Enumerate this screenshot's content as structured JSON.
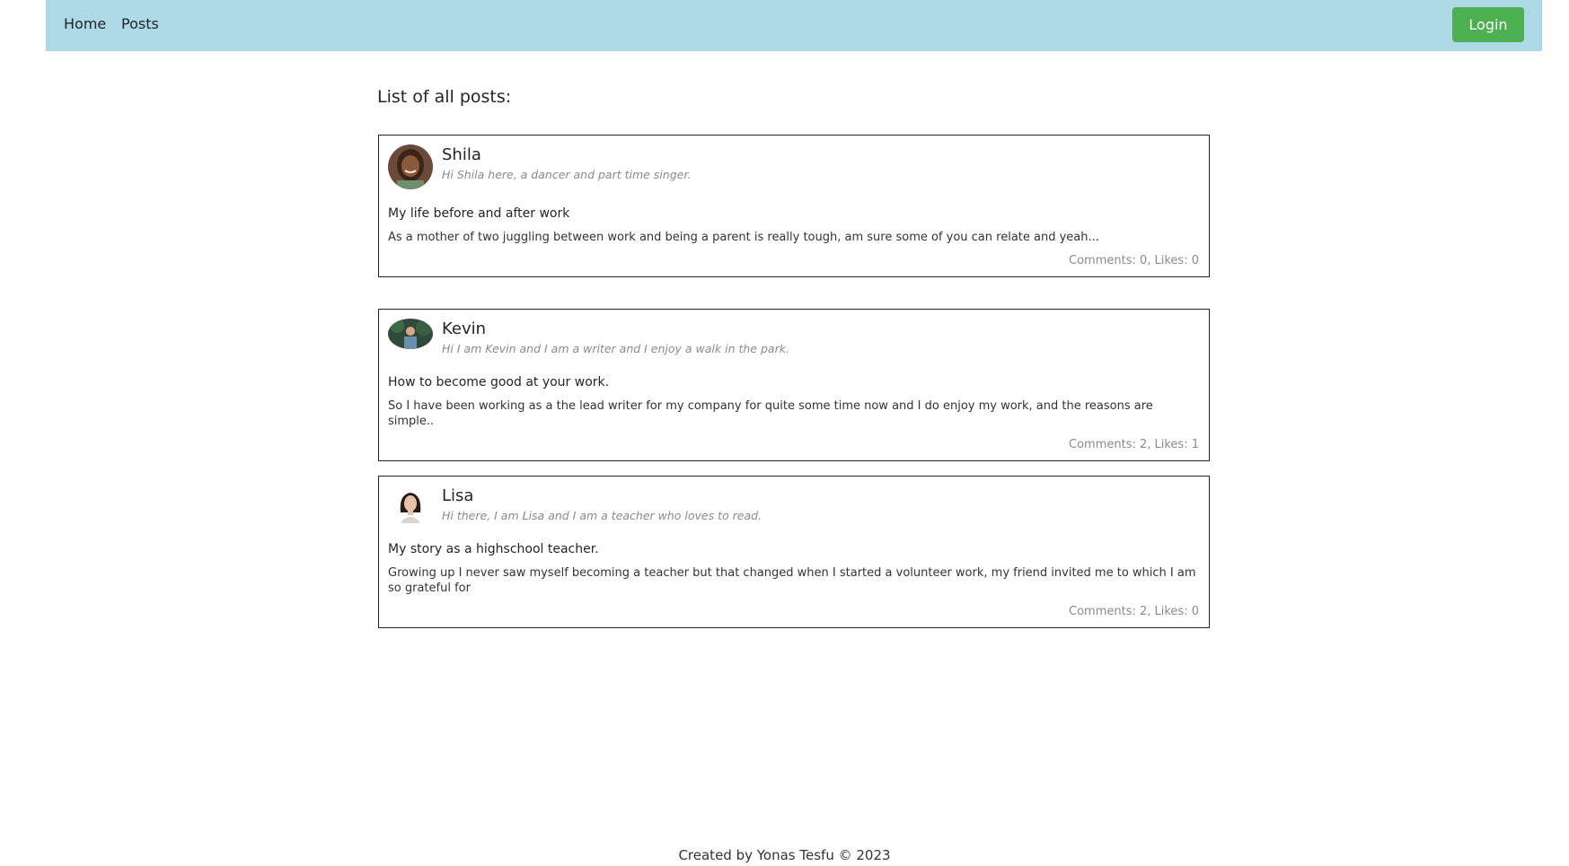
{
  "nav": {
    "home_label": "Home",
    "posts_label": "Posts",
    "login_label": "Login"
  },
  "colors": {
    "navbar_bg": "#add8e6",
    "login_bg": "#4caf50",
    "muted_text": "#8a8a8a"
  },
  "page": {
    "heading": "List of all posts:"
  },
  "posts": [
    {
      "author": "Shila",
      "bio": "Hi Shila here, a dancer and part time singer.",
      "avatar_icon": "avatar-shila",
      "title": "My life before and after work",
      "body": "As a mother of two juggling between work and being a parent is really tough, am sure some of you can relate and yeah...",
      "meta": "Comments: 0, Likes: 0"
    },
    {
      "author": "Kevin",
      "bio": "Hi I am Kevin and I am a writer and I enjoy a walk in the park.",
      "avatar_icon": "avatar-kevin",
      "title": "How to become good at your work.",
      "body": "So I have been working as a the lead writer for my company for quite some time now and I do enjoy my work, and the reasons are simple..",
      "meta": "Comments: 2, Likes: 1"
    },
    {
      "author": "Lisa",
      "bio": "Hi there, I am Lisa and I am a teacher who loves to read.",
      "avatar_icon": "avatar-lisa",
      "title": "My story as a highschool teacher.",
      "body": "Growing up I never saw myself becoming a teacher but that changed when I started a volunteer work, my friend invited me to which I am so grateful for",
      "meta": "Comments: 2, Likes: 0"
    }
  ],
  "footer": {
    "text": "Created by Yonas Tesfu © 2023"
  }
}
